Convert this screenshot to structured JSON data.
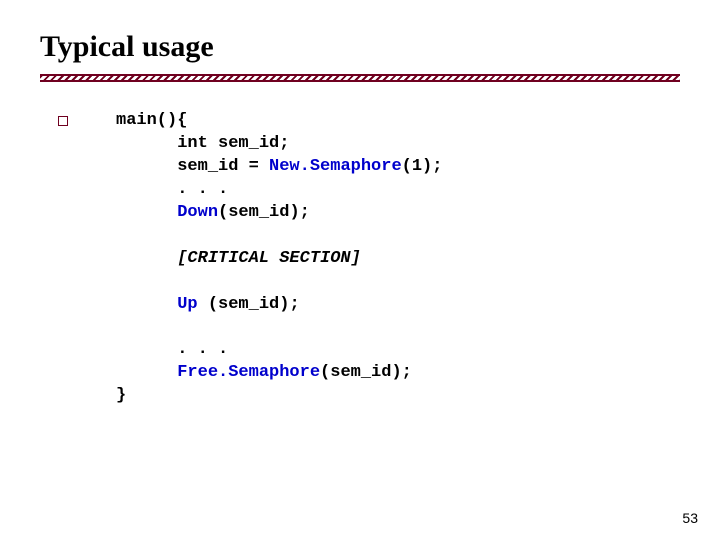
{
  "title": "Typical usage",
  "code": {
    "l1": "main(){",
    "l2": "      int sem_id;",
    "l3a": "      sem_id = ",
    "l3b": "New.Semaphore",
    "l3c": "(1);",
    "l4": "      . . .",
    "l5a": "      ",
    "l5b": "Down",
    "l5c": "(sem_id);",
    "blank": "",
    "l6": "      [CRITICAL SECTION]",
    "l7a": "      ",
    "l7b": "Up ",
    "l7c": "(sem_id);",
    "l8": "      . . .",
    "l9a": "      ",
    "l9b": "Free.Semaphore",
    "l9c": "(sem_id);",
    "l10": "}"
  },
  "page_number": "53"
}
